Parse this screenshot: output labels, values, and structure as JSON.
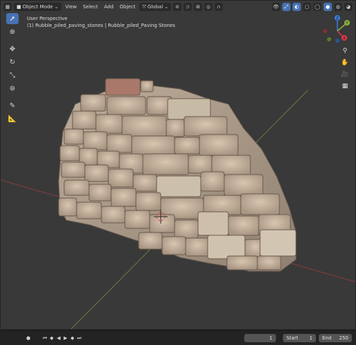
{
  "header": {
    "editor_type_icon": "viewport-editor-icon",
    "mode_label": "Object Mode",
    "menus": [
      "View",
      "Select",
      "Add",
      "Object"
    ],
    "transform_orientation": "Global"
  },
  "viewport": {
    "perspective_label": "User Perspective",
    "object_label": "(1) Rubble_piled_paving_stones | Rubble_piled_Paving Stones"
  },
  "gizmo": {
    "z_label": "Z",
    "y_label": "Y",
    "x_label": "X"
  },
  "timeline": {
    "current_frame": "1",
    "start_label": "Start",
    "start_value": "1",
    "end_label": "End",
    "end_value": "250"
  },
  "colors": {
    "viewport_bg": "#393939",
    "active_tool": "#4772b3",
    "axis_x": "#e4394d",
    "axis_y": "#8bb63a",
    "axis_z": "#3f7fe0"
  }
}
